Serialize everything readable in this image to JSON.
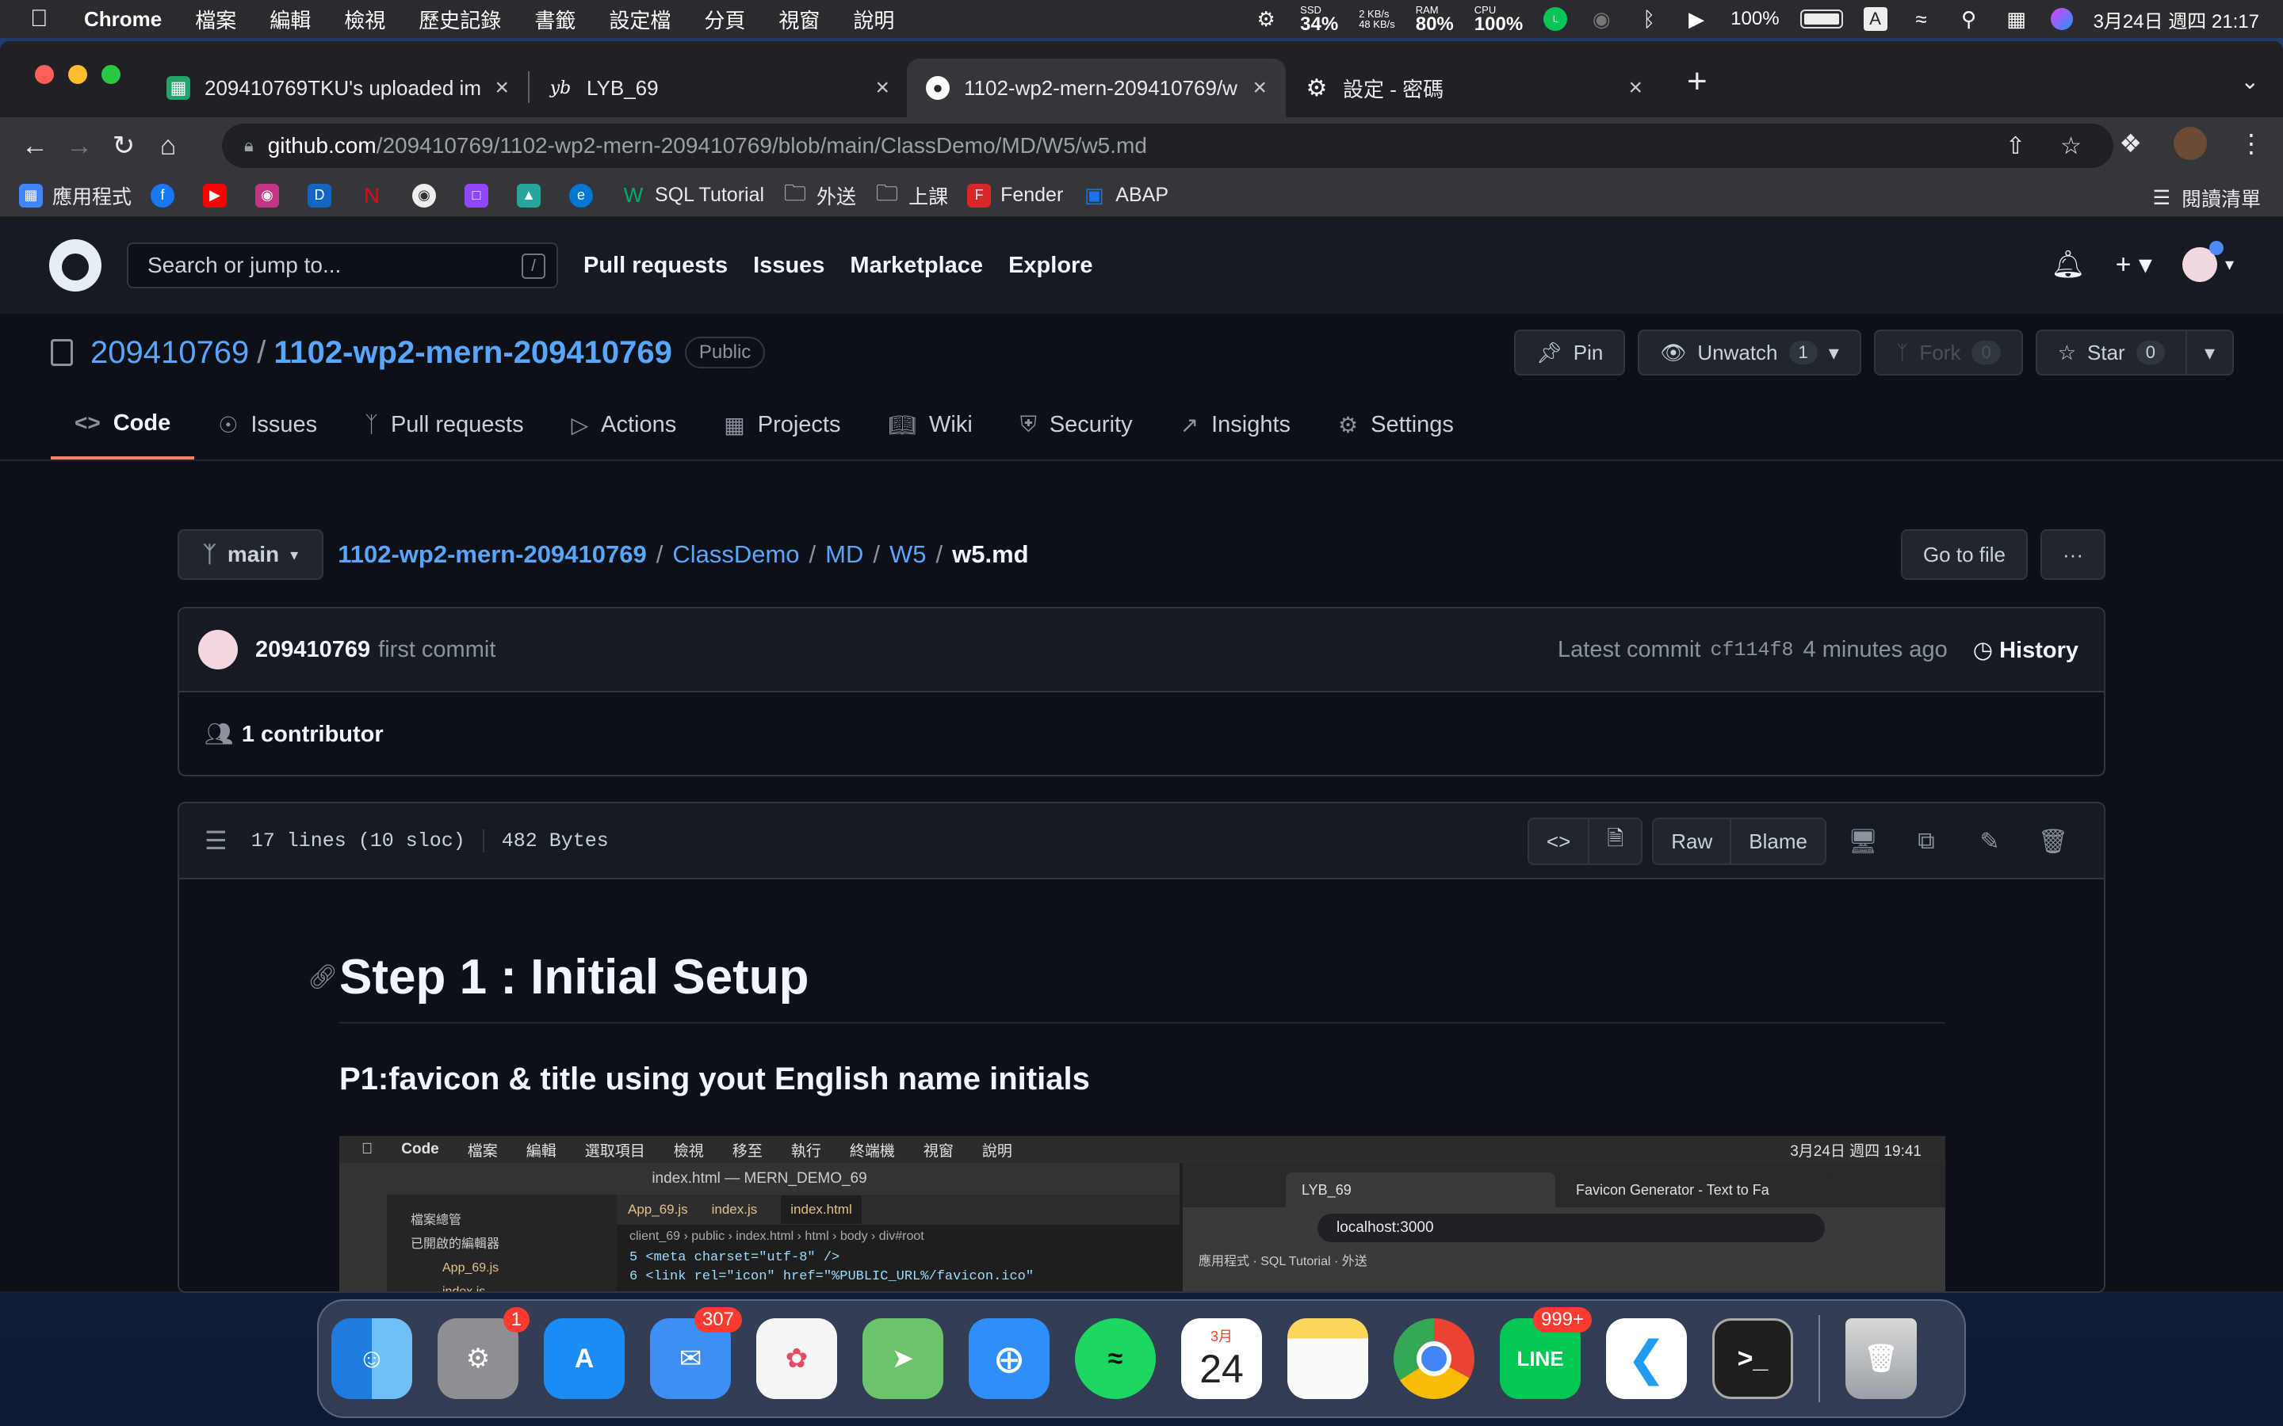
{
  "menubar": {
    "app": "Chrome",
    "items": [
      "檔案",
      "編輯",
      "檢視",
      "歷史記錄",
      "書籤",
      "設定檔",
      "分頁",
      "視窗",
      "說明"
    ],
    "ssd_label": "SSD",
    "ssd": "34%",
    "net_up": "2 KB/s",
    "net_down": "48 KB/s",
    "ram_label": "RAM",
    "ram": "80%",
    "cpu_label": "CPU",
    "cpu": "100%",
    "battery": "100%",
    "input_method": "A",
    "datetime": "3月24日 週四  21:17"
  },
  "browser": {
    "tabs": [
      {
        "title": "209410769TKU's uploaded im",
        "color": "#20a46b"
      },
      {
        "title": "LYB_69",
        "color": "#202124"
      },
      {
        "title": "1102-wp2-mern-209410769/w",
        "color": "#24292f"
      },
      {
        "title": "設定 - 密碼",
        "color": "#5f6368"
      }
    ],
    "url_host": "github.com",
    "url_path": "/209410769/1102-wp2-mern-209410769/blob/main/ClassDemo/MD/W5/w5.md",
    "bookmarks": [
      {
        "label": "應用程式",
        "color": "#4285f4"
      },
      {
        "label": "",
        "color": "#1877f2"
      },
      {
        "label": "",
        "color": "#ff0000"
      },
      {
        "label": "",
        "color": "#c13584"
      },
      {
        "label": "",
        "color": "#1565c0"
      },
      {
        "label": "",
        "color": "#e50914"
      },
      {
        "label": "",
        "color": "#555555"
      },
      {
        "label": "",
        "color": "#9146ff"
      },
      {
        "label": "",
        "color": "#26a69a"
      },
      {
        "label": "",
        "color": "#0078d4"
      },
      {
        "label": "SQL Tutorial",
        "color": "#04aa6d"
      },
      {
        "label": "外送",
        "color": "#9aa0a6"
      },
      {
        "label": "上課",
        "color": "#9aa0a6"
      },
      {
        "label": "Fender",
        "color": "#d62828"
      },
      {
        "label": "ABAP",
        "color": "#1a73e8"
      }
    ],
    "reading_list": "閱讀清單"
  },
  "github": {
    "search_placeholder": "Search or jump to...",
    "search_key": "/",
    "nav": [
      "Pull requests",
      "Issues",
      "Marketplace",
      "Explore"
    ],
    "repo_owner": "209410769",
    "repo_name": "1102-wp2-mern-209410769",
    "visibility": "Public",
    "pin": "Pin",
    "unwatch": "Unwatch",
    "watch_count": "1",
    "fork": "Fork",
    "fork_count": "0",
    "star": "Star",
    "star_count": "0",
    "tabs": [
      "Code",
      "Issues",
      "Pull requests",
      "Actions",
      "Projects",
      "Wiki",
      "Security",
      "Insights",
      "Settings"
    ],
    "branch": "main",
    "crumbs": [
      "1102-wp2-mern-209410769",
      "ClassDemo",
      "MD",
      "W5"
    ],
    "current_file": "w5.md",
    "go_to_file": "Go to file",
    "more": "···",
    "commit_author": "209410769",
    "commit_message": "first commit",
    "latest_commit": "Latest commit",
    "commit_sha": "cf114f8",
    "commit_time": "4 minutes ago",
    "history": "History",
    "contributors": "1 contributor",
    "file_lines": "17 lines (10 sloc)",
    "file_size": "482 Bytes",
    "raw": "Raw",
    "blame": "Blame",
    "md_h1": "Step 1 : Initial Setup",
    "md_h3": "P1:favicon & title using yout English name initials"
  },
  "embedded_screenshot": {
    "menubar": [
      "Code",
      "檔案",
      "編輯",
      "選取項目",
      "檢視",
      "移至",
      "執行",
      "終端機",
      "視窗",
      "說明"
    ],
    "datetime": "3月24日 週四  19:41",
    "editor_title": "index.html — MERN_DEMO_69",
    "explorer_title": "檔案總管",
    "open_editors": "已開啟的編輯器",
    "files": [
      "App_69.js",
      "index.js"
    ],
    "editor_tabs": [
      "App_69.js",
      "index.js",
      "index.html"
    ],
    "breadcrumb": "client_69 › public › index.html › html › body › div#root",
    "code_lines": [
      "5    <meta charset=\"utf-8\" />",
      "6    <link rel=\"icon\" href=\"%PUBLIC_URL%/favicon.ico\""
    ],
    "browser_tabs": [
      "LYB_69",
      "Favicon Generator - Text to Fa"
    ],
    "url": "localhost:3000",
    "bookmarks": "應用程式 · SQL Tutorial · 外送"
  },
  "dock": {
    "apps": [
      {
        "name": "finder",
        "color": "#3a8de0",
        "label": ""
      },
      {
        "name": "system-preferences",
        "color": "#8e8e93",
        "label": "",
        "badge": "1"
      },
      {
        "name": "app-store",
        "color": "#1c8cf5",
        "label": "A"
      },
      {
        "name": "mail",
        "color": "#3d8ef5",
        "label": "",
        "badge": "307"
      },
      {
        "name": "photos",
        "color": "#f5f5f5",
        "label": ""
      },
      {
        "name": "maps",
        "color": "#6cc46a",
        "label": ""
      },
      {
        "name": "safari",
        "color": "#2f8ef7",
        "label": ""
      },
      {
        "name": "spotify",
        "color": "#1ed760",
        "label": ""
      },
      {
        "name": "calendar",
        "color": "#ffffff",
        "label": "24"
      },
      {
        "name": "notes",
        "color": "#fbd65a",
        "label": ""
      },
      {
        "name": "chrome",
        "color": "#e8eaed",
        "label": ""
      },
      {
        "name": "line",
        "color": "#06c755",
        "label": "LINE",
        "badge": "999+"
      },
      {
        "name": "vscode",
        "color": "#1f9cf0",
        "label": ""
      },
      {
        "name": "terminal",
        "color": "#1e1e1e",
        "label": ">_"
      },
      {
        "name": "trash",
        "color": "#9aa0a6",
        "label": ""
      }
    ],
    "calendar_month": "3月"
  }
}
